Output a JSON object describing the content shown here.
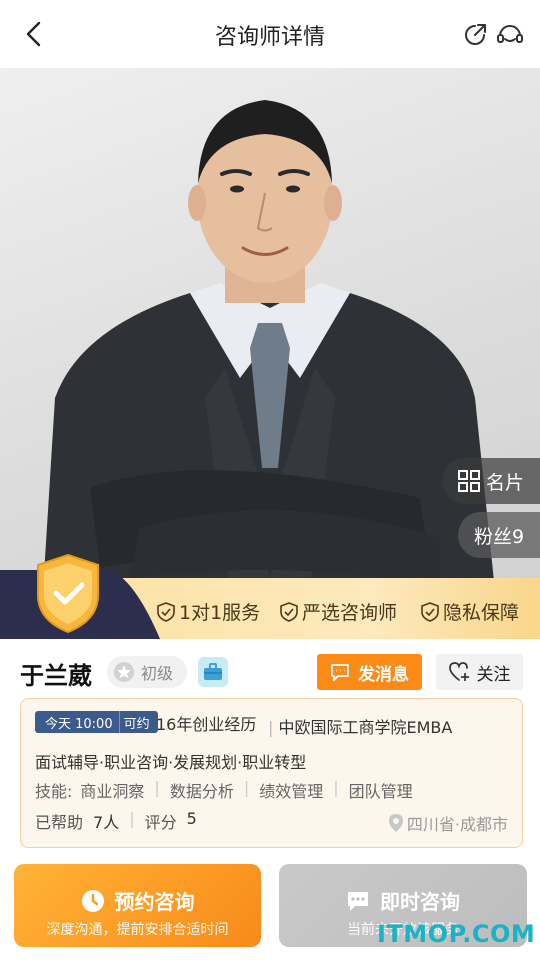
{
  "header": {
    "title": "咨询师详情"
  },
  "hero": {
    "card_label": "名片",
    "fans_label": "粉丝9"
  },
  "guarantees": [
    "1对1服务",
    "严选咨询师",
    "隐私保障"
  ],
  "profile": {
    "name": "于兰葳",
    "level": "初级",
    "message_label": "发消息",
    "follow_label": "关注"
  },
  "info": {
    "available_time": "今天 10:00",
    "available_suffix": "可约",
    "experience": "16年创业经历",
    "education": "中欧国际工商学院EMBA",
    "areas": "面试辅导·职业咨询·发展规划·职业转型",
    "skills_label": "技能:",
    "skills": [
      "商业洞察",
      "数据分析",
      "绩效管理",
      "团队管理"
    ],
    "helped_label": "已帮助",
    "helped_value": "7人",
    "rating_label": "评分",
    "rating_value": "5",
    "location": "四川省·成都市"
  },
  "actions": {
    "book_title": "预约咨询",
    "book_sub": "深度沟通，提前安排合适时间",
    "instant_title": "即时咨询",
    "instant_sub": "当前未开放该服务"
  },
  "watermark": "ITMOP.COM",
  "colors": {
    "accent_orange": "#fb8a16",
    "tag_blue": "#3d5a8c",
    "card_bg": "#fdf6ec",
    "disabled_gray": "#c4c4c4"
  }
}
